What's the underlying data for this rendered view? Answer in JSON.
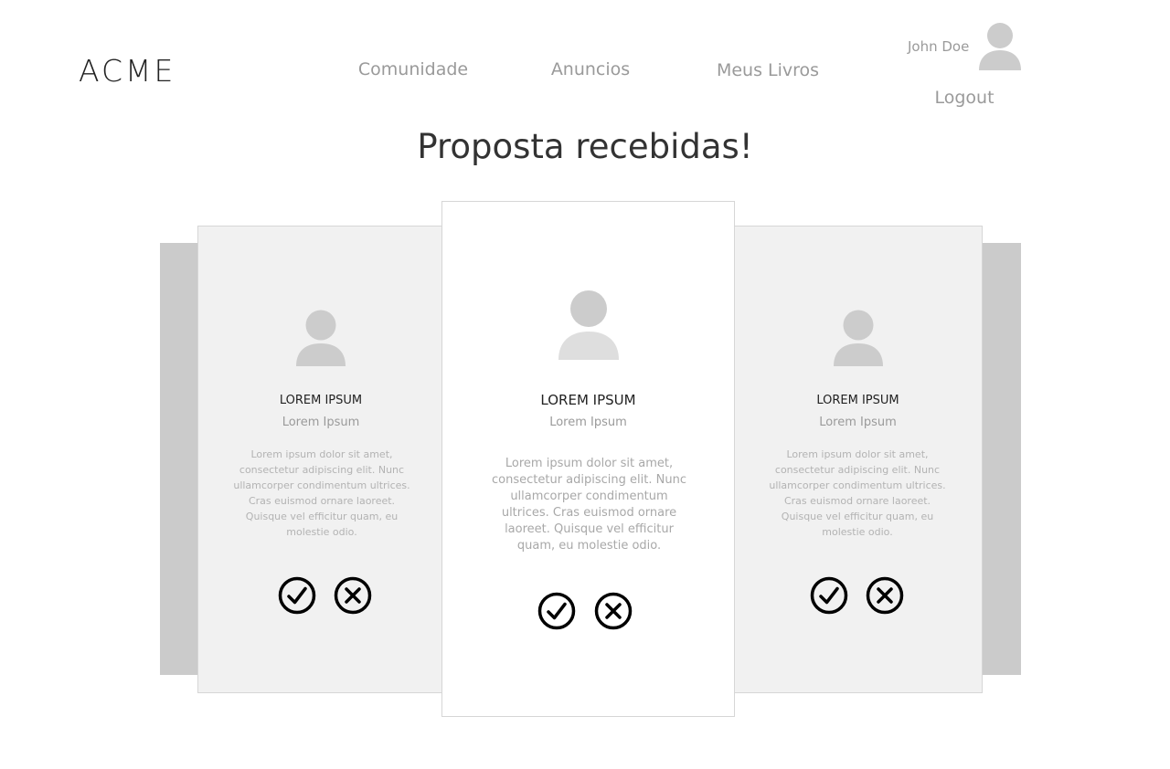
{
  "header": {
    "logo": "ACME",
    "nav": [
      "Comunidade",
      "Anuncios",
      "Meus Livros"
    ],
    "user_name": "John Doe",
    "logout": "Logout"
  },
  "title": "Proposta recebidas!",
  "cards": [
    {
      "name": "LOREM IPSUM",
      "subtitle": "Lorem Ipsum",
      "text": "Lorem ipsum dolor sit amet, consectetur adipiscing elit. Nunc ullamcorper condimentum ultrices. Cras euismod ornare laoreet. Quisque vel efficitur quam, eu molestie odio."
    },
    {
      "name": "LOREM IPSUM",
      "subtitle": "Lorem Ipsum",
      "text": "Lorem ipsum dolor sit amet, consectetur adipiscing elit. Nunc ullamcorper condimentum ultrices. Cras euismod ornare laoreet. Quisque vel efficitur quam, eu molestie odio."
    },
    {
      "name": "LOREM IPSUM",
      "subtitle": "Lorem Ipsum",
      "text": "Lorem ipsum dolor sit amet, consectetur adipiscing elit. Nunc ullamcorper condimentum ultrices. Cras euismod ornare laoreet. Quisque vel efficitur quam, eu molestie odio."
    }
  ],
  "icons": {
    "accept": "check-circle-icon",
    "reject": "x-circle-icon",
    "avatar": "user-icon"
  },
  "colors": {
    "text_muted": "#9a9a9a",
    "card_side_bg": "#f1f1f1",
    "back_panel": "#cbcbcb",
    "avatar_gray": "#cccccc"
  }
}
